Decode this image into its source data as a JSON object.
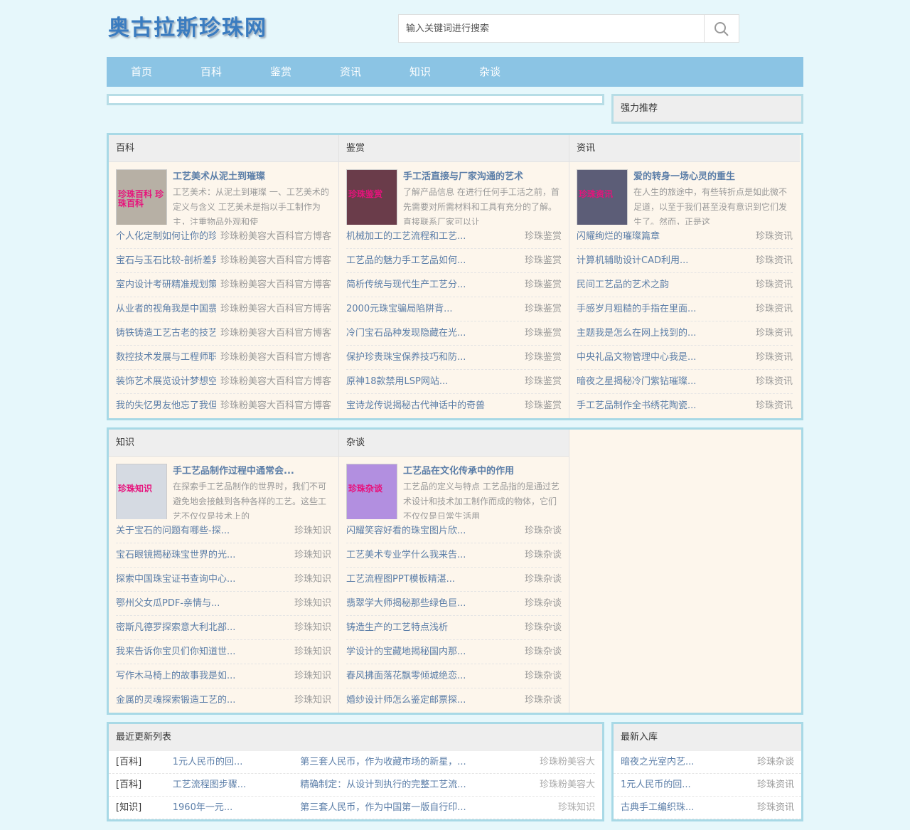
{
  "site": {
    "logo_text": "奥古拉斯珍珠网"
  },
  "search": {
    "placeholder": "输入关键词进行搜索"
  },
  "nav": [
    "首页",
    "百科",
    "鉴赏",
    "资讯",
    "知识",
    "杂谈"
  ],
  "recommend_label": "强力推荐",
  "section1": [
    {
      "head": "百科",
      "thumb_caption": "珍珠百科 珍珠百科",
      "feat_title": "工艺美术从泥土到璀璨",
      "feat_desc": "工艺美术：从泥土到璀璨 一、工艺美术的定义与含义 工艺美术是指以手工制作为主，注重物品外观和使",
      "items": [
        [
          "个人化定制如何让你的珍珠",
          "珍珠粉美容大百科官方博客"
        ],
        [
          "宝石与玉石比较-剖析差异",
          "珍珠粉美容大百科官方博客"
        ],
        [
          "室内设计考研精准规划策略",
          "珍珠粉美容大百科官方博客"
        ],
        [
          "从业者的视角我是中国翡翠",
          "珍珠粉美容大百科官方博客"
        ],
        [
          "铸铁铸造工艺古老的技艺",
          "珍珠粉美容大百科官方博客"
        ],
        [
          "数控技术发展与工程师职业",
          "珍珠粉美容大百科官方博客"
        ],
        [
          "装饰艺术展览设计梦想空间",
          "珍珠粉美容大百科官方博客"
        ],
        [
          "我的失忆男友他忘了我但我记得他",
          "珍珠粉美容大百科官方博客"
        ]
      ]
    },
    {
      "head": "鉴赏",
      "thumb_caption": "珍珠鉴赏",
      "feat_title": "手工活直接与厂家沟通的艺术",
      "feat_desc": "了解产品信息 在进行任何手工活之前，首先需要对所需材料和工具有充分的了解。直接联系厂家可以让",
      "items": [
        [
          "机械加工的工艺流程和工艺...",
          "珍珠鉴赏"
        ],
        [
          "工艺品的魅力手工艺品如何...",
          "珍珠鉴赏"
        ],
        [
          "简析传统与现代生产工艺分...",
          "珍珠鉴赏"
        ],
        [
          "2000元珠宝骗局陷阱背...",
          "珍珠鉴赏"
        ],
        [
          "冷门宝石品种发现隐藏在光...",
          "珍珠鉴赏"
        ],
        [
          "保护珍贵珠宝保养技巧和防...",
          "珍珠鉴赏"
        ],
        [
          "原神18款禁用LSP网站...",
          "珍珠鉴赏"
        ],
        [
          "宝诗龙传说揭秘古代神话中的奇兽",
          "珍珠鉴赏"
        ]
      ]
    },
    {
      "head": "资讯",
      "thumb_caption": "珍珠资讯",
      "feat_title": "爱的转身一场心灵的重生",
      "feat_desc": "在人生的旅途中，有些转折点是如此微不足道，以至于我们甚至没有意识到它们发生了。然而，正是这",
      "items": [
        [
          "闪耀绚烂的璀璨篇章",
          "珍珠资讯"
        ],
        [
          "计算机辅助设计CAD利用...",
          "珍珠资讯"
        ],
        [
          "民间工艺品的艺术之韵",
          "珍珠资讯"
        ],
        [
          "手感岁月粗糙的手指在里面...",
          "珍珠资讯"
        ],
        [
          "主题我是怎么在网上找到的...",
          "珍珠资讯"
        ],
        [
          "中央礼品文物管理中心我是...",
          "珍珠资讯"
        ],
        [
          "暗夜之星揭秘冷门紫钻璀璨...",
          "珍珠资讯"
        ],
        [
          "手工艺品制作全书绣花陶瓷...",
          "珍珠资讯"
        ]
      ]
    }
  ],
  "section2": [
    {
      "head": "知识",
      "thumb_caption": "珍珠知识",
      "feat_title": "手工艺品制作过程中通常会...",
      "feat_desc": "在探索手工艺品制作的世界时，我们不可避免地会接触到各种各样的工艺。这些工艺不仅仅是技术上的",
      "items": [
        [
          "关于宝石的问题有哪些-探...",
          "珍珠知识"
        ],
        [
          "宝石眼镜揭秘珠宝世界的光...",
          "珍珠知识"
        ],
        [
          "探索中国珠宝证书查询中心...",
          "珍珠知识"
        ],
        [
          "鄂州父女瓜PDF-亲情与...",
          "珍珠知识"
        ],
        [
          "密斯凡德罗探索意大利北部...",
          "珍珠知识"
        ],
        [
          "我来告诉你宝贝们你知道世...",
          "珍珠知识"
        ],
        [
          "写作木马椅上的故事我是如...",
          "珍珠知识"
        ],
        [
          "金属的灵魂探索锻造工艺的...",
          "珍珠知识"
        ]
      ]
    },
    {
      "head": "杂谈",
      "thumb_caption": "珍珠杂谈",
      "feat_title": "工艺品在文化传承中的作用",
      "feat_desc": "工艺品的定义与特点 工艺品指的是通过艺术设计和技术加工制作而成的物体，它们不仅仅是日常生活用",
      "items": [
        [
          "闪耀笑容好看的珠宝图片欣...",
          "珍珠杂谈"
        ],
        [
          "工艺美术专业学什么我来告...",
          "珍珠杂谈"
        ],
        [
          "工艺流程图PPT模板精湛...",
          "珍珠杂谈"
        ],
        [
          "翡翠学大师揭秘那些绿色巨...",
          "珍珠杂谈"
        ],
        [
          "铸造生产的工艺特点浅析",
          "珍珠杂谈"
        ],
        [
          "学设计的宝藏地揭秘国内那...",
          "珍珠杂谈"
        ],
        [
          "春风拂面落花飘零倾城绝恋...",
          "珍珠杂谈"
        ],
        [
          "婚纱设计师怎么鉴定邮票探...",
          "珍珠杂谈"
        ]
      ]
    }
  ],
  "latest": {
    "head": "最近更新列表",
    "rows": [
      [
        "[百科]",
        "1元人民币的回...",
        "第三套人民币，作为收藏市场的新星，...",
        "珍珠粉美容大"
      ],
      [
        "[百科]",
        "工艺流程图步骤...",
        "精确制定：从设计到执行的完整工艺流...",
        "珍珠粉美容大"
      ],
      [
        "[知识]",
        "1960年一元...",
        "第三套人民币，作为中国第一版自行印...",
        "珍珠知识"
      ]
    ]
  },
  "newest": {
    "head": "最新入库",
    "rows": [
      [
        "暗夜之光室内艺...",
        "珍珠杂谈"
      ],
      [
        "1元人民币的回...",
        "珍珠资讯"
      ],
      [
        "古典手工编织珠...",
        "珍珠资讯"
      ]
    ]
  },
  "colors": {
    "nav_bg": "#8bc4e4",
    "page_bg": "#e6f7fb",
    "border": "#a8d9e6",
    "link": "#5b7ea8"
  }
}
